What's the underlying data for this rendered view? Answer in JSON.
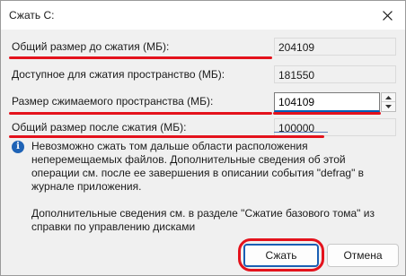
{
  "window": {
    "title": "Сжать C:"
  },
  "fields": [
    {
      "label": "Общий размер до сжатия (МБ):",
      "value": "204109"
    },
    {
      "label": "Доступное для сжатия пространство (МБ):",
      "value": "181550"
    },
    {
      "label": "Размер сжимаемого пространства (МБ):",
      "value": "104109"
    },
    {
      "label": "Общий размер после сжатия (МБ):",
      "value": "100000"
    }
  ],
  "info": {
    "icon": "info-icon",
    "text": "Невозможно сжать том дальше области расположения неперемещаемых файлов. Дополнительные сведения об этой операции см. после ее завершения в описании события \"defrag\" в журнале приложения."
  },
  "more_info": "Дополнительные сведения см. в разделе \"Сжатие базового тома\" из справки по управлению дисками",
  "buttons": {
    "shrink_label": "Сжать",
    "cancel_label": "Отмена"
  },
  "colors": {
    "annotation_red": "#e4121c",
    "accent_blue": "#005fb8",
    "info_icon_blue": "#1f63b6"
  }
}
